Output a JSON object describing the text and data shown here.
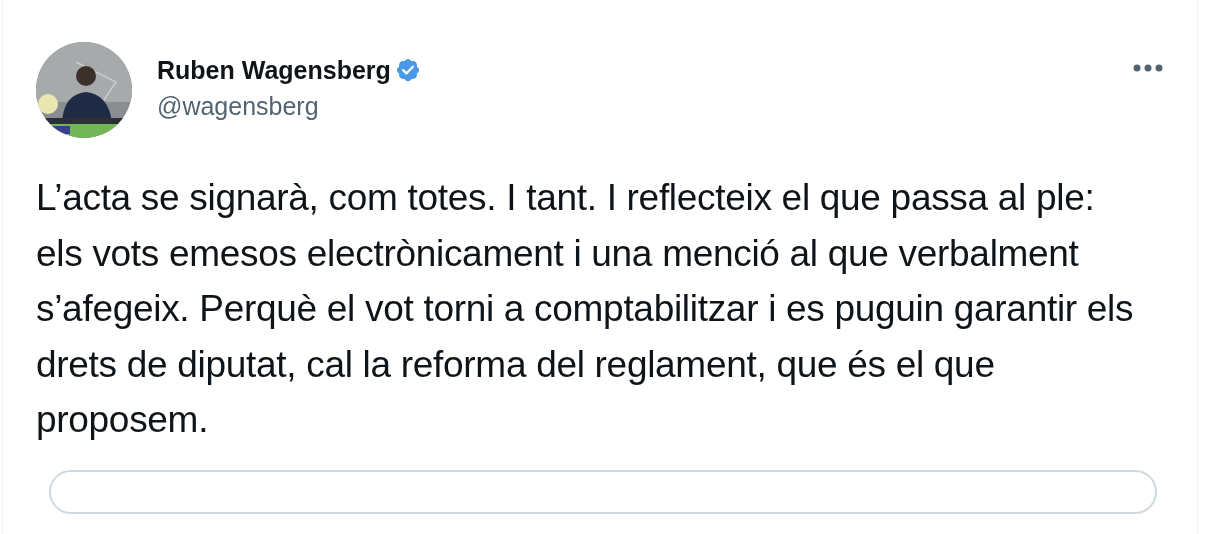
{
  "author": {
    "name": "Ruben Wagensberg",
    "verified": true,
    "handle": "@wagensberg"
  },
  "tweet": {
    "text": "L’acta se signarà, com totes. I tant. I reflecteix el que passa al ple: els vots emesos electrònicament i una menció al que verbalment s’afegeix. Perquè el vot torni a comptabilitzar i es puguin garantir els drets de diputat, cal la reforma del reglament, que és el que proposem."
  }
}
